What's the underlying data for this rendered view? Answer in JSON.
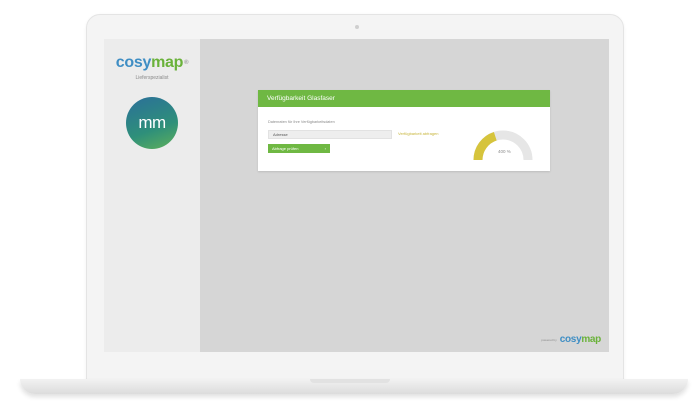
{
  "sidebar": {
    "brand_part1": "cosy",
    "brand_part2": "map",
    "brand_mark": "®",
    "subtitle": "Lieferspezialist",
    "avatar_text": "mm"
  },
  "card": {
    "title": "Verfügbarkeit Glasfaser",
    "input_label": "Datenraten für Ihre Verfügbarkeitsdaten",
    "input_value": "Adresse",
    "compare_link": "Verfügbarkeit abfragen",
    "button_label": "Abfrage prüfen",
    "button_icon": "chevron-right-icon",
    "gauge_value_text": "400 %",
    "gauge_fraction": 0.4
  },
  "footer": {
    "powered_label": "powered by",
    "brand_part1": "cosy",
    "brand_part2": "map"
  },
  "colors": {
    "accent_green": "#6fb843",
    "brand_blue": "#3f8ec4",
    "gauge_fill": "#d6c43c",
    "gauge_track": "#e6e6e6"
  }
}
